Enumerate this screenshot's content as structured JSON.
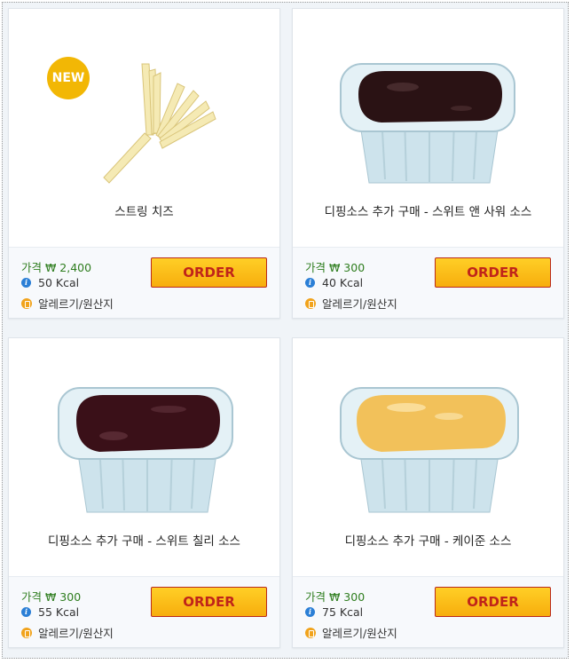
{
  "products": [
    {
      "name": "스트링 치즈",
      "price": "가격 ₩ 2,400",
      "kcal": "50 Kcal",
      "allergy": "알레르기/원산지",
      "order_label": "ORDER",
      "badge": "NEW"
    },
    {
      "name": "디핑소스 추가 구매 - 스위트 앤 사워 소스",
      "price": "가격 ₩ 300",
      "kcal": "40 Kcal",
      "allergy": "알레르기/원산지",
      "order_label": "ORDER"
    },
    {
      "name": "디핑소스 추가 구매 - 스위트 칠리 소스",
      "price": "가격 ₩ 300",
      "kcal": "55 Kcal",
      "allergy": "알레르기/원산지",
      "order_label": "ORDER"
    },
    {
      "name": "디핑소스 추가 구매 - 케이준 소스",
      "price": "가격 ₩ 300",
      "kcal": "75 Kcal",
      "allergy": "알레르기/원산지",
      "order_label": "ORDER"
    }
  ],
  "colors": {
    "order_bg": "#f7ad0d",
    "order_text": "#c0241a",
    "price_text": "#2e7d1e",
    "badge": "#f2b705",
    "sauce_sweet_sour": "#2a1214",
    "sauce_sweet_chili": "#3a1018",
    "sauce_cajun": "#f2c15a"
  }
}
